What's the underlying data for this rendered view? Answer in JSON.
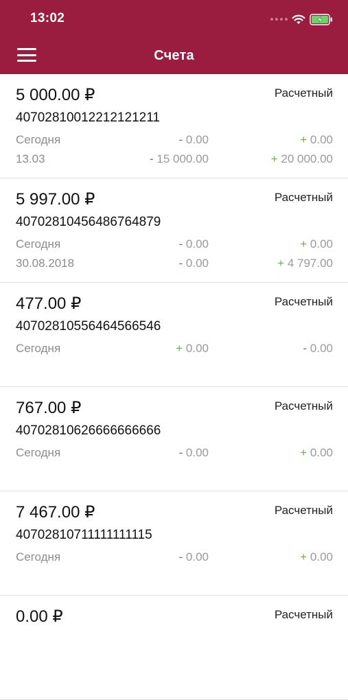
{
  "status_bar": {
    "time": "13:02"
  },
  "header": {
    "title": "Счета"
  },
  "accounts": [
    {
      "amount": "5 000.00 ₽",
      "type": "Расчетный",
      "number": "40702810012212121211",
      "rows": [
        {
          "label": "Сегодня",
          "mid_sign": "-",
          "mid_value": "0.00",
          "end_sign": "+",
          "end_value": "0.00"
        },
        {
          "label": "13.03",
          "mid_sign": "-",
          "mid_value": "15 000.00",
          "end_sign": "+",
          "end_value": "20 000.00"
        }
      ]
    },
    {
      "amount": "5 997.00 ₽",
      "type": "Расчетный",
      "number": "40702810456486764879",
      "rows": [
        {
          "label": "Сегодня",
          "mid_sign": "-",
          "mid_value": "0.00",
          "end_sign": "+",
          "end_value": "0.00"
        },
        {
          "label": "30.08.2018",
          "mid_sign": "-",
          "mid_value": "0.00",
          "end_sign": "+",
          "end_value": "4 797.00"
        }
      ]
    },
    {
      "amount": "477.00 ₽",
      "type": "Расчетный",
      "number": "40702810556464566546",
      "rows": [
        {
          "label": "Сегодня",
          "mid_sign": "+",
          "mid_value": "0.00",
          "end_sign": "-",
          "end_value": "0.00"
        }
      ]
    },
    {
      "amount": "767.00 ₽",
      "type": "Расчетный",
      "number": "40702810626666666666",
      "rows": [
        {
          "label": "Сегодня",
          "mid_sign": "-",
          "mid_value": "0.00",
          "end_sign": "+",
          "end_value": "0.00"
        }
      ]
    },
    {
      "amount": "7 467.00 ₽",
      "type": "Расчетный",
      "number": "40702810711111111115",
      "rows": [
        {
          "label": "Сегодня",
          "mid_sign": "-",
          "mid_value": "0.00",
          "end_sign": "+",
          "end_value": "0.00"
        }
      ]
    },
    {
      "amount": "0.00 ₽",
      "type": "Расчетный",
      "number": "",
      "rows": []
    }
  ],
  "colors": {
    "header_bg": "#9a1d3f",
    "minus": "#b94a66",
    "plus": "#6ab04c",
    "muted": "#8c8c8c"
  },
  "icons": [
    "signal-icon",
    "wifi-icon",
    "battery-charging-icon",
    "menu-icon"
  ]
}
